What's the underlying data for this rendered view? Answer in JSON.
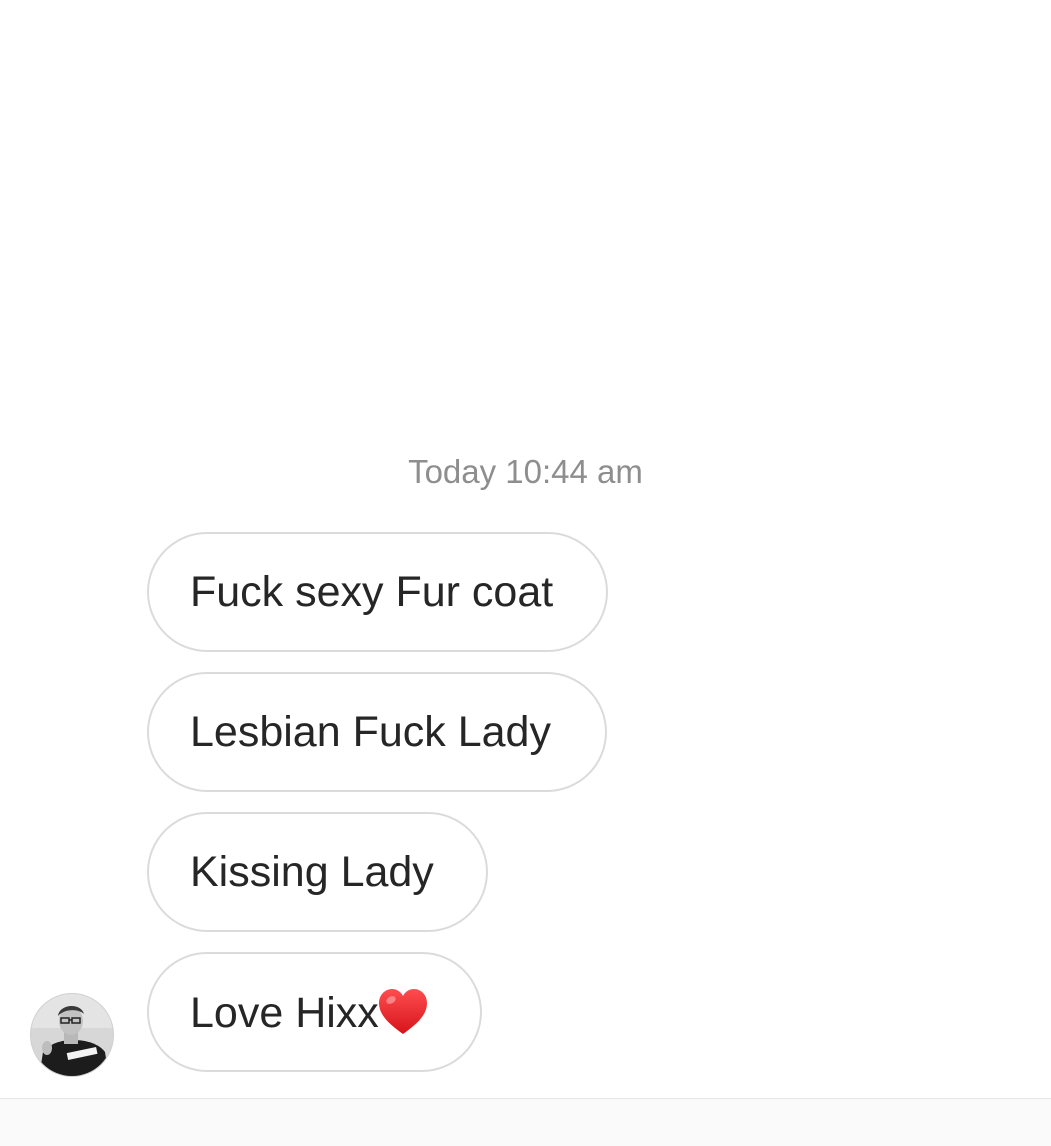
{
  "thread": {
    "timestamp": "Today 10:44 am",
    "messages": [
      {
        "text": "Fuck sexy Fur coat",
        "emoji": ""
      },
      {
        "text": "Lesbian Fuck Lady",
        "emoji": ""
      },
      {
        "text": "Kissing Lady",
        "emoji": ""
      },
      {
        "text": "Love Hixx",
        "emoji": "heart-icon"
      }
    ]
  },
  "sender": {
    "avatar": "avatar-photo"
  },
  "colors": {
    "background": "#ffffff",
    "bubble_border": "#dbdbdb",
    "bubble_text": "#262626",
    "timestamp": "#8e8e8e",
    "heart": "#e8191b",
    "composer_bar": "#fafafa"
  }
}
